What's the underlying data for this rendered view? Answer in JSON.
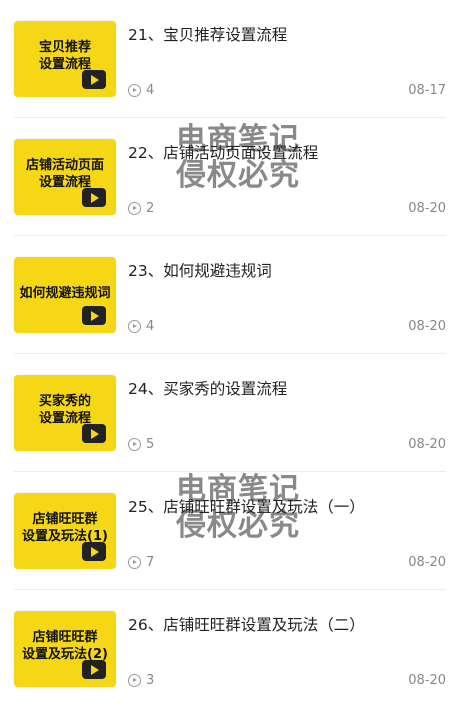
{
  "lessons": [
    {
      "thumb": "宝贝推荐\n设置流程",
      "title": "21、宝贝推荐设置流程",
      "plays": "4",
      "date": "08-17"
    },
    {
      "thumb": "店铺活动页面\n设置流程",
      "title": "22、店铺活动页面设置流程",
      "plays": "2",
      "date": "08-20"
    },
    {
      "thumb": "如何规避违规词",
      "title": "23、如何规避违规词",
      "plays": "4",
      "date": "08-20"
    },
    {
      "thumb": "买家秀的\n设置流程",
      "title": "24、买家秀的设置流程",
      "plays": "5",
      "date": "08-20"
    },
    {
      "thumb": "店铺旺旺群\n设置及玩法(1)",
      "title": "25、店铺旺旺群设置及玩法（一）",
      "plays": "7",
      "date": "08-20"
    },
    {
      "thumb": "店铺旺旺群\n设置及玩法(2)",
      "title": "26、店铺旺旺群设置及玩法（二）",
      "plays": "3",
      "date": "08-20"
    }
  ],
  "watermarks": [
    {
      "line1": "电商笔记",
      "line2": "侵权必究"
    },
    {
      "line1": "电商笔记",
      "line2": "侵权必究"
    }
  ]
}
